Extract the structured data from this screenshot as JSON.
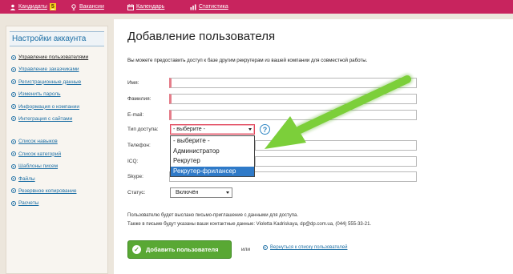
{
  "topnav": {
    "items": [
      {
        "label": "Кандидаты",
        "badge": "5",
        "icon": "person-icon"
      },
      {
        "label": "Вакансии",
        "icon": "vacancy-icon"
      },
      {
        "label": "Календарь",
        "icon": "calendar-icon"
      },
      {
        "label": "Статистика",
        "icon": "statistics-icon"
      }
    ]
  },
  "sidebar": {
    "title": "Настройки аккаунта",
    "group1": [
      "Управление пользователями",
      "Управление заказчиками",
      "Регистрационные данные",
      "Изменить пароль",
      "Информация о компании",
      "Интеграция с сайтами"
    ],
    "group2": [
      "Список навыков",
      "Список категорий",
      "Шаблоны писем",
      "Файлы",
      "Резервное копирование",
      "Расчеты"
    ],
    "active_index": 0
  },
  "main": {
    "title": "Добавление пользователя",
    "intro": "Вы можете предоставить доступ к базе другим рекрутерам из вашей компании для совместной работы."
  },
  "form": {
    "name_label": "Имя:",
    "surname_label": "Фамилия:",
    "email_label": "E-mail:",
    "access_label": "Тип доступа:",
    "access_value": "- выберите -",
    "phone_label": "Телефон:",
    "icq_label": "ICQ:",
    "skype_label": "Skype:",
    "status_label": "Статус:",
    "status_value": "Включён",
    "help_symbol": "?",
    "access_options": [
      "- выберите -",
      "Администратор",
      "Рекрутер",
      "Рекрутер-фрилансер"
    ],
    "access_highlighted": 3
  },
  "info": {
    "line1": "Пользователю будет выслано письмо-приглашение с данными для доступа.",
    "line2": "Также в письме будут указаны ваши контактные данные: Violetta Kadriskaya, dp@dp.com.ua, (044) 555-33-21."
  },
  "actions": {
    "add_label": "Добавить пользователя",
    "check_symbol": "✓",
    "or_label": "или",
    "back_label": "Вернуться к списку пользователей"
  },
  "colors": {
    "topbar": "#c8245e",
    "link": "#1d6fa5",
    "button": "#59a834",
    "annotation_arrow": "#7ccf3a"
  }
}
